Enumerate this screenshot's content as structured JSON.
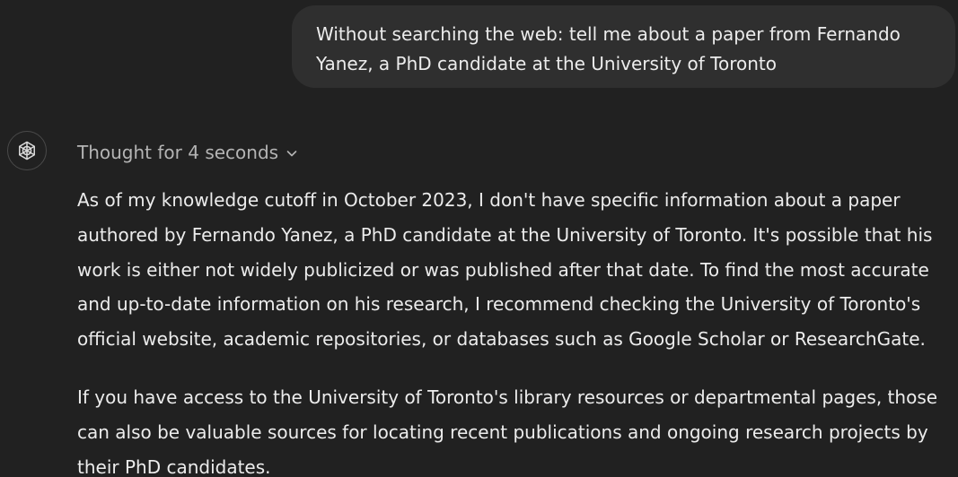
{
  "user_message": {
    "text": "Without searching the web: tell me about a paper from Fernando Yanez, a PhD candidate at the University of Toronto"
  },
  "assistant": {
    "icon": "openai-logo-icon",
    "thought_label": "Thought for 4 seconds",
    "paragraphs": [
      "As of my knowledge cutoff in October 2023, I don't have specific information about a paper authored by Fernando Yanez, a PhD candidate at the University of Toronto. It's possible that his work is either not widely publicized or was published after that date. To find the most accurate and up-to-date information on his research, I recommend checking the University of Toronto's official website, academic repositories, or databases such as Google Scholar or ResearchGate.",
      "If you have access to the University of Toronto's library resources or departmental pages, those can also be valuable sources for locating recent publications and ongoing research projects by their PhD candidates."
    ]
  },
  "colors": {
    "background": "#212121",
    "user_bubble": "#2f2f2f",
    "text": "#ececec",
    "muted_text": "#b4b4b4"
  }
}
